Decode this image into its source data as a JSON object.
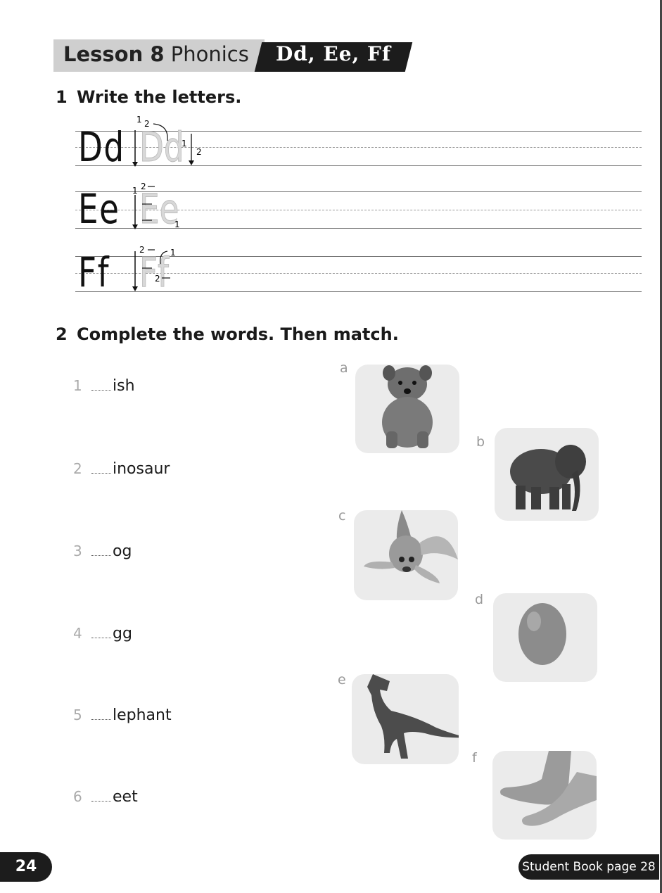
{
  "header": {
    "lesson": "Lesson 8",
    "topic": "Phonics",
    "letters": "Dd, Ee, Ff"
  },
  "exercise1": {
    "number": "1",
    "title": "Write the letters.",
    "rows": [
      {
        "model": "Dd",
        "trace": "Dd"
      },
      {
        "model": "Ee",
        "trace": "Ee"
      },
      {
        "model": "Ff",
        "trace": "Ff"
      }
    ]
  },
  "exercise2": {
    "number": "2",
    "title": "Complete the words. Then match.",
    "words": [
      {
        "num": "1",
        "text": "ish"
      },
      {
        "num": "2",
        "text": "inosaur"
      },
      {
        "num": "3",
        "text": "og"
      },
      {
        "num": "4",
        "text": "gg"
      },
      {
        "num": "5",
        "text": "lephant"
      },
      {
        "num": "6",
        "text": "eet"
      }
    ],
    "pictures": [
      {
        "label": "a",
        "icon": "dog-photo"
      },
      {
        "label": "b",
        "icon": "elephant-photo"
      },
      {
        "label": "c",
        "icon": "fish-photo"
      },
      {
        "label": "d",
        "icon": "egg-photo"
      },
      {
        "label": "e",
        "icon": "dinosaur-photo"
      },
      {
        "label": "f",
        "icon": "feet-photo"
      }
    ]
  },
  "footer": {
    "page_number": "24",
    "student_book_ref": "Student Book page 28"
  }
}
